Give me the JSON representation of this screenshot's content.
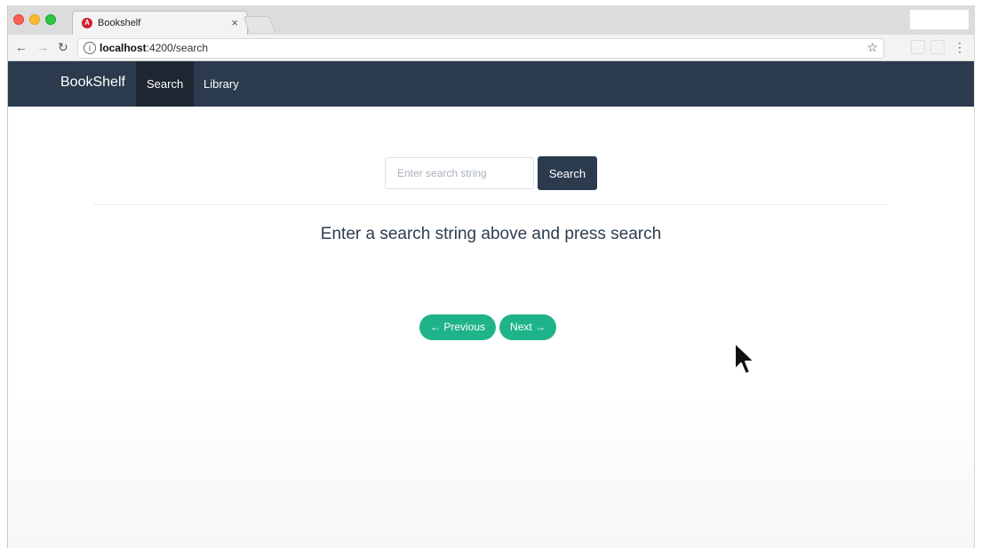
{
  "browser": {
    "tab_title": "Bookshelf",
    "tab_close": "×",
    "url_host": "localhost",
    "url_path": ":4200/search",
    "icons": {
      "favicon": "angular-logo-icon",
      "back": "arrow-left-icon",
      "forward": "arrow-right-icon",
      "reload": "reload-icon",
      "info": "info-icon",
      "bookmark": "star-icon",
      "menu": "kebab-menu-icon"
    }
  },
  "navbar": {
    "brand": "BookShelf",
    "items": [
      {
        "label": "Search",
        "active": true
      },
      {
        "label": "Library",
        "active": false
      }
    ]
  },
  "search": {
    "placeholder": "Enter search string",
    "value": "",
    "button_label": "Search"
  },
  "message": "Enter a search string above and press search",
  "pagination": {
    "previous_label": "← Previous",
    "next_label": "Next →"
  },
  "colors": {
    "navbar_bg": "#2b3a4d",
    "accent_green": "#1fb38a",
    "text_dark": "#2c3e50"
  }
}
